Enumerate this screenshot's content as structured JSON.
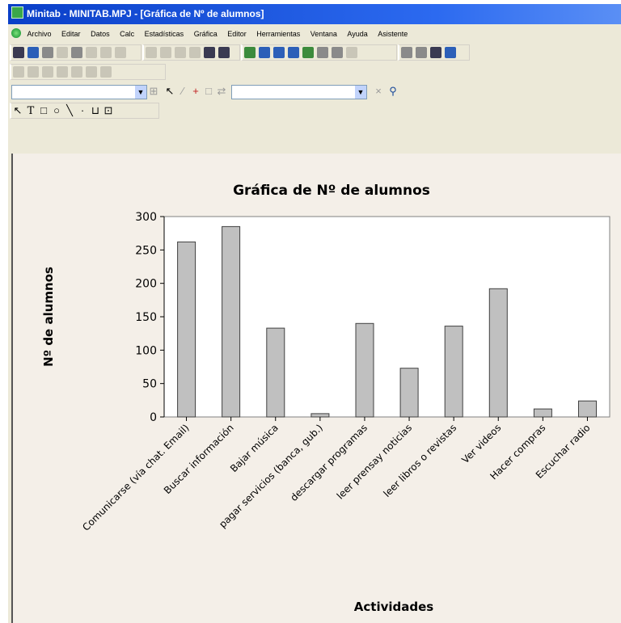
{
  "window": {
    "title": "Minitab - MINITAB.MPJ - [Gráfica de Nº de alumnos]"
  },
  "menubar": {
    "items": [
      "Archivo",
      "Editar",
      "Datos",
      "Calc",
      "Estadísticas",
      "Gráfica",
      "Editor",
      "Herramientas",
      "Ventana",
      "Ayuda",
      "Asistente"
    ]
  },
  "toolbar": {
    "icons": [
      "open-icon",
      "save-icon",
      "print-icon",
      "cut-icon",
      "copy-icon",
      "paste-icon",
      "undo-icon",
      "redo-icon",
      "help-icon",
      "project-manager-icon",
      "session-icon",
      "data-icon",
      "graph-icon"
    ],
    "graph_tools": [
      "select-tool-icon",
      "text-tool-icon",
      "rectangle-tool-icon",
      "ellipse-tool-icon",
      "line-tool-icon",
      "marker-tool-icon",
      "polygon-tool-icon",
      "polyline-tool-icon"
    ]
  },
  "colors": {
    "titlebar": "#0a3fc8",
    "window_bg": "#ece9d8",
    "graph_bg": "#f4efe8",
    "bar_fill": "#c0c0c0",
    "bar_stroke": "#404040"
  },
  "chart_data": {
    "type": "bar",
    "title": "Gráfica de Nº de alumnos",
    "xlabel": "Actividades",
    "ylabel": "Nº de alumnos",
    "ylim": [
      0,
      300
    ],
    "yticks": [
      0,
      50,
      100,
      150,
      200,
      250,
      300
    ],
    "grid": false,
    "categories": [
      "Comunicarse (vía chat. Email)",
      "Buscar información",
      "Bajar música",
      "pagar servicios (banca, gub.)",
      "descargar programas",
      "leer prensay noticias",
      "leer libros o revistas",
      "Ver videos",
      "Hacer compras",
      "Escuchar radio"
    ],
    "values": [
      262,
      285,
      133,
      5,
      140,
      73,
      136,
      192,
      12,
      24
    ]
  }
}
